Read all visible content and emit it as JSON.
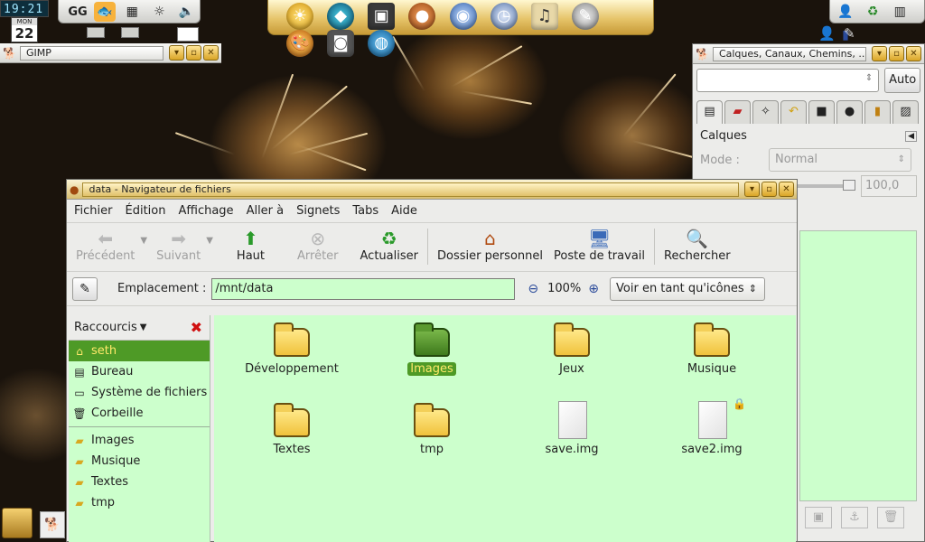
{
  "panel": {
    "clock": "19:21",
    "calendar_month": "MON",
    "calendar_day": "22",
    "launcher_icons": [
      "gg-icon",
      "fish-icon",
      "network-icon",
      "brightness-icon",
      "volume-icon"
    ],
    "tray_icons": [
      "user-icon",
      "refresh-icon",
      "devices-icon",
      "signal-icon",
      "person-icon",
      "tool-icon"
    ]
  },
  "dock": {
    "icons": [
      "sun-icon",
      "gem-icon",
      "terminal-icon",
      "bread-icon",
      "globe-bird-icon",
      "clock-icon",
      "media-icon",
      "pen-icon",
      "palette-icon",
      "camera-icon",
      "earth-icon"
    ]
  },
  "gimp_toolbox": {
    "title": "GIMP"
  },
  "layers_window": {
    "title": "Calques, Canaux, Chemins, ...",
    "auto_button": "Auto",
    "section_title": "Calques",
    "mode_label": "Mode :",
    "mode_value": "Normal",
    "opacity_value": "100,0"
  },
  "file_manager": {
    "title": "data  -  Navigateur de fichiers",
    "menu": [
      "Fichier",
      "Édition",
      "Affichage",
      "Aller à",
      "Signets",
      "Tabs",
      "Aide"
    ],
    "toolbar": {
      "back": "Précédent",
      "forward": "Suivant",
      "up": "Haut",
      "stop": "Arrêter",
      "refresh": "Actualiser",
      "home": "Dossier personnel",
      "computer": "Poste de travail",
      "search": "Rechercher"
    },
    "location_label": "Emplacement :",
    "location_value": "/mnt/data",
    "zoom_level": "100%",
    "view_mode": "Voir en tant qu'icônes",
    "sidebar_title": "Raccourcis",
    "places": [
      "seth",
      "Bureau",
      "Système de fichiers",
      "Corbeille"
    ],
    "bookmarks": [
      "Images",
      "Musique",
      "Textes",
      "tmp"
    ],
    "files": [
      {
        "name": "Développement",
        "kind": "folder"
      },
      {
        "name": "Images",
        "kind": "folder-selected"
      },
      {
        "name": "Jeux",
        "kind": "folder"
      },
      {
        "name": "Musique",
        "kind": "folder"
      },
      {
        "name": "Textes",
        "kind": "folder"
      },
      {
        "name": "tmp",
        "kind": "folder"
      },
      {
        "name": "save.img",
        "kind": "file"
      },
      {
        "name": "save2.img",
        "kind": "file-locked"
      }
    ]
  }
}
